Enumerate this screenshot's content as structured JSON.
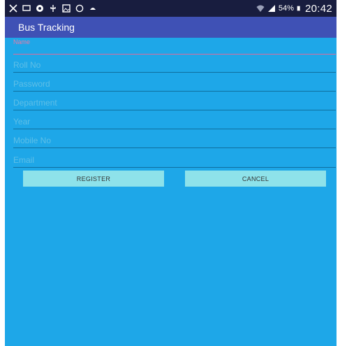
{
  "status_bar": {
    "battery": "54%",
    "clock": "20:42",
    "icons_left": [
      "tools-icon",
      "cast-icon",
      "chrome-icon",
      "usb-icon",
      "image-icon",
      "whatsapp-icon",
      "android-icon"
    ],
    "icons_right": [
      "wifi-icon",
      "signal-icon",
      "battery-icon"
    ]
  },
  "app_bar": {
    "title": "Bus Tracking"
  },
  "form": {
    "name_placeholder": "Name",
    "roll_no_placeholder": "Roll No",
    "password_placeholder": "Password",
    "department_placeholder": "Department",
    "year_placeholder": "Year",
    "mobile_no_placeholder": "Mobile No",
    "email_placeholder": "Email"
  },
  "buttons": {
    "register": "REGISTER",
    "cancel": "CANCEL"
  },
  "colors": {
    "background": "#1ea7e8",
    "app_bar": "#3f51b5",
    "status_bar": "#181d3f",
    "button": "#8ee2ea",
    "focus_line": "#e06b9a"
  }
}
